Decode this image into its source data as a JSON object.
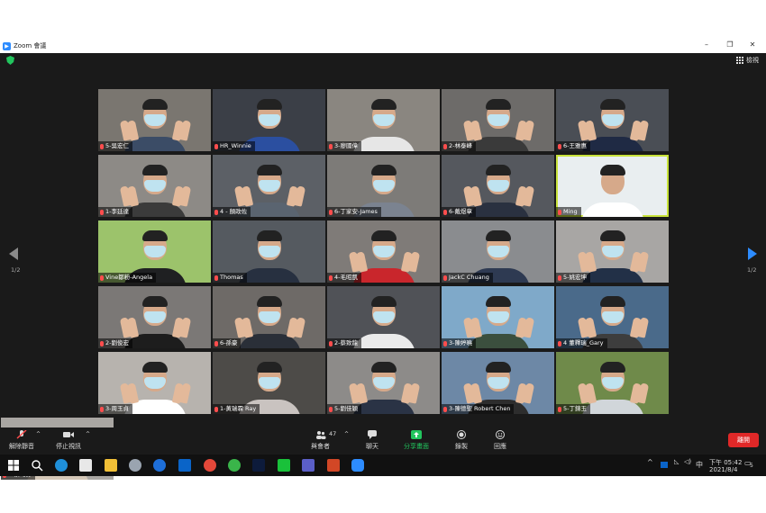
{
  "window": {
    "title": "Zoom 會議",
    "view_label": "檢視"
  },
  "participants": [
    {
      "name": "5-吳宏仁",
      "hands": true,
      "mask": true
    },
    {
      "name": "HR_Winnie",
      "hands": false,
      "mask": true
    },
    {
      "name": "3-廖國偉",
      "hands": false,
      "mask": true
    },
    {
      "name": "2-林泰峰",
      "hands": true,
      "mask": true
    },
    {
      "name": "6-王雅惠",
      "hands": true,
      "mask": true
    },
    {
      "name": "1-李廷達",
      "hands": true,
      "mask": true
    },
    {
      "name": "4 - 顏政佐",
      "hands": true,
      "mask": true
    },
    {
      "name": "6-丁家安-James",
      "hands": false,
      "mask": true
    },
    {
      "name": "6-戴煜章",
      "hands": true,
      "mask": true
    },
    {
      "name": "Ming",
      "hands": false,
      "mask": false,
      "active": true
    },
    {
      "name": "Vine鄒粉-Angela",
      "hands": false,
      "mask": true
    },
    {
      "name": "Thomas",
      "hands": false,
      "mask": true
    },
    {
      "name": "4-毛昭凱",
      "hands": true,
      "mask": true
    },
    {
      "name": "JackC Chuang",
      "hands": false,
      "mask": true
    },
    {
      "name": "5-姚宏坤",
      "hands": true,
      "mask": true
    },
    {
      "name": "2-劉俊宏",
      "hands": true,
      "mask": true
    },
    {
      "name": "6-孫豪",
      "hands": true,
      "mask": true
    },
    {
      "name": "2-蔡致龍",
      "hands": false,
      "mask": true
    },
    {
      "name": "3-陳婷曉",
      "hands": true,
      "mask": true
    },
    {
      "name": "4 董釋瑞_Gary",
      "hands": true,
      "mask": true
    },
    {
      "name": "3-周玉貞",
      "hands": true,
      "mask": true
    },
    {
      "name": "1-黃瑞霖 Ray",
      "hands": false,
      "mask": true
    },
    {
      "name": "5-劉佳穎",
      "hands": true,
      "mask": true
    },
    {
      "name": "3-陳德聖 Robert Chen",
      "hands": true,
      "mask": true
    },
    {
      "name": "5-丁錦玉",
      "hands": true,
      "mask": true
    },
    {
      "name": "2-蔡巧芬",
      "hands": true,
      "mask": true
    }
  ],
  "pagination": {
    "left": "1/2",
    "right": "1/2"
  },
  "toolbar": {
    "mute": "解除靜音",
    "video": "停止視訊",
    "participants_count": "47",
    "participants": "與會者",
    "chat": "聊天",
    "share": "分享畫面",
    "record": "錄製",
    "reactions": "回應",
    "end": "離開"
  },
  "tray": {
    "ime": "中",
    "time": "下午 05:42",
    "date": "2021/8/4",
    "notifications": "5"
  },
  "colors": {
    "share_green": "#22c55e",
    "end_red": "#e02828",
    "active_speaker": "#c8e23a",
    "zoom_blue": "#2d8cff"
  }
}
